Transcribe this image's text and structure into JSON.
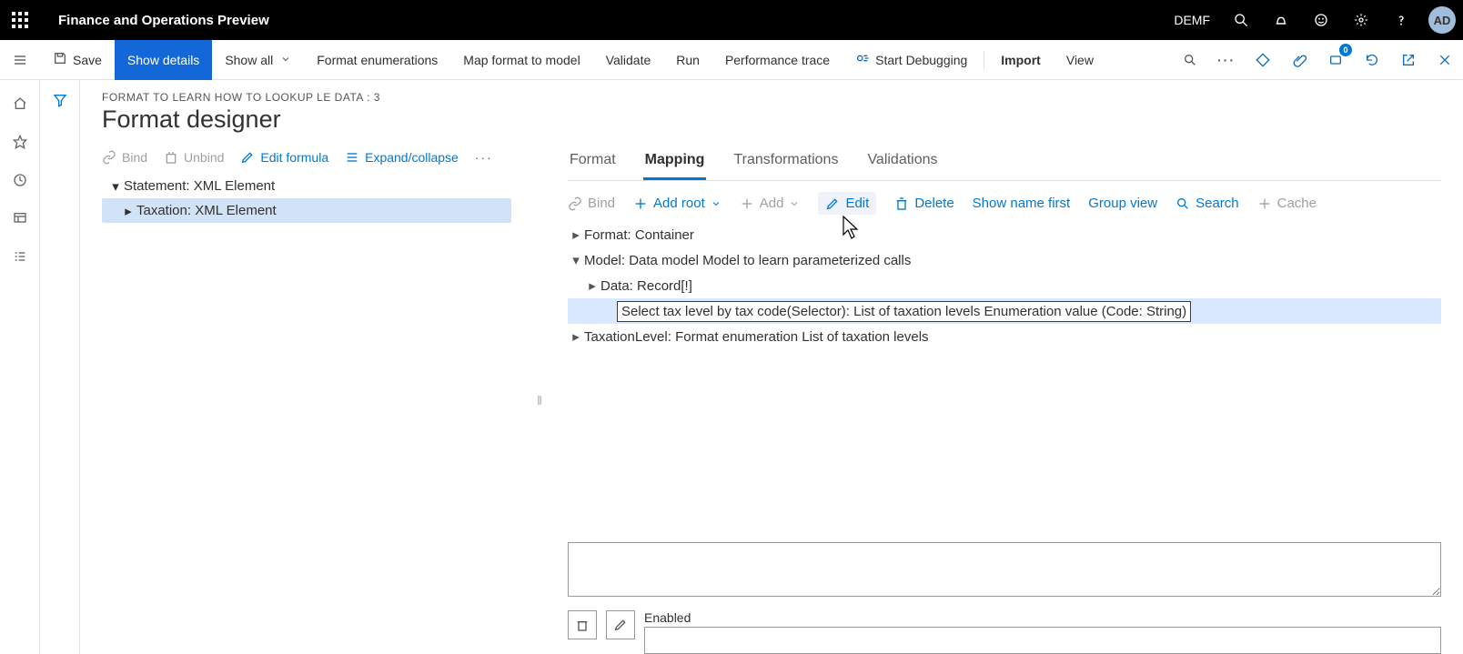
{
  "titlebar": {
    "app_name": "Finance and Operations Preview",
    "company": "DEMF",
    "avatar": "AD"
  },
  "cmdbar": {
    "save": "Save",
    "show_details": "Show details",
    "show_all": "Show all",
    "format_enum": "Format enumerations",
    "map_format": "Map format to model",
    "validate": "Validate",
    "run": "Run",
    "perf_trace": "Performance trace",
    "start_debug": "Start Debugging",
    "import": "Import",
    "view": "View",
    "badge_count": "0"
  },
  "page": {
    "breadcrumb": "FORMAT TO LEARN HOW TO LOOKUP LE DATA : 3",
    "title": "Format designer"
  },
  "left_toolbar": {
    "bind": "Bind",
    "unbind": "Unbind",
    "edit_formula": "Edit formula",
    "expand_collapse": "Expand/collapse"
  },
  "left_tree": {
    "n0": {
      "label": "Statement: XML Element"
    },
    "n1": {
      "label": "Taxation: XML Element"
    }
  },
  "tabs": {
    "format": "Format",
    "mapping": "Mapping",
    "transformations": "Transformations",
    "validations": "Validations"
  },
  "right_toolbar": {
    "bind": "Bind",
    "add_root": "Add root",
    "add": "Add",
    "edit": "Edit",
    "delete": "Delete",
    "show_name_first": "Show name first",
    "group_view": "Group view",
    "search": "Search",
    "cache": "Cache"
  },
  "right_tree": {
    "n0": {
      "label": "Format: Container"
    },
    "n1": {
      "label": "Model: Data model Model to learn parameterized calls"
    },
    "n2": {
      "label": "Data: Record[!]"
    },
    "n3": {
      "label": "Select tax level by tax code(Selector): List of taxation levels Enumeration value (Code: String)"
    },
    "n4": {
      "label": "TaxationLevel: Format enumeration List of taxation levels"
    }
  },
  "bottom": {
    "enabled_label": "Enabled"
  }
}
